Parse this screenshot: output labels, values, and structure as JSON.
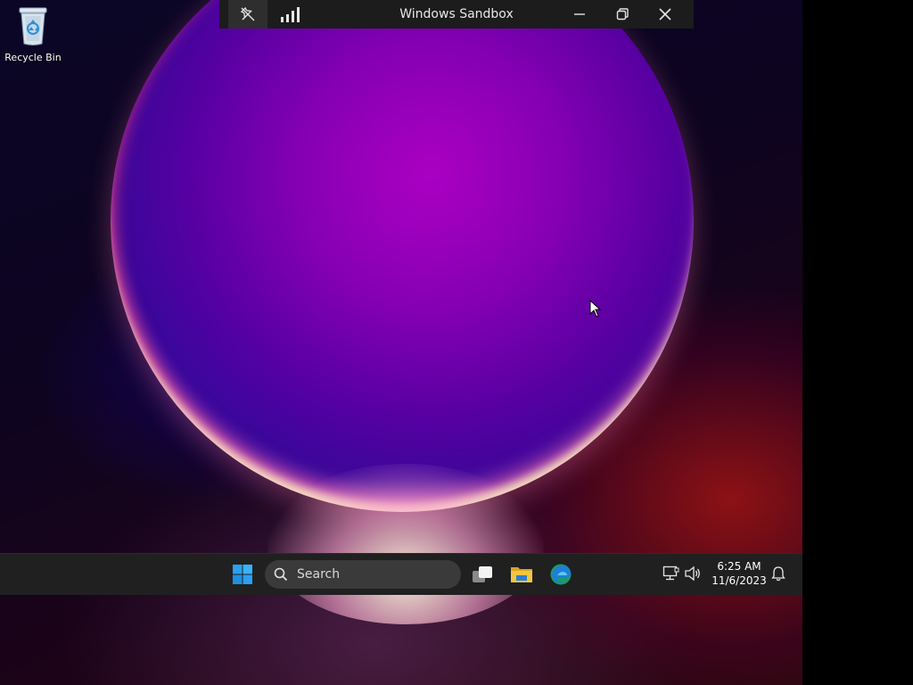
{
  "window": {
    "title": "Windows Sandbox"
  },
  "titlebar_buttons": {
    "pin_icon": "unpin-icon",
    "signal_icon": "connection-bars-icon",
    "minimize_icon": "minimize-icon",
    "restore_icon": "restore-icon",
    "close_icon": "close-icon"
  },
  "desktop": {
    "icons": [
      {
        "label": "Recycle Bin",
        "icon": "recycle-bin-icon"
      }
    ]
  },
  "taskbar": {
    "search_placeholder": "Search",
    "apps": [
      "start-icon",
      "task-view-icon",
      "file-explorer-icon",
      "edge-icon"
    ],
    "tray": {
      "time": "6:25 AM",
      "date": "11/6/2023",
      "network_icon": "network-icon",
      "volume_icon": "volume-icon",
      "notification_icon": "bell-icon"
    }
  },
  "colors": {
    "taskbar_bg": "#202020",
    "titlebar_bg": "#1c1c1c",
    "start_blue": "#2aa0f0",
    "folder_yellow": "#f4c542"
  }
}
